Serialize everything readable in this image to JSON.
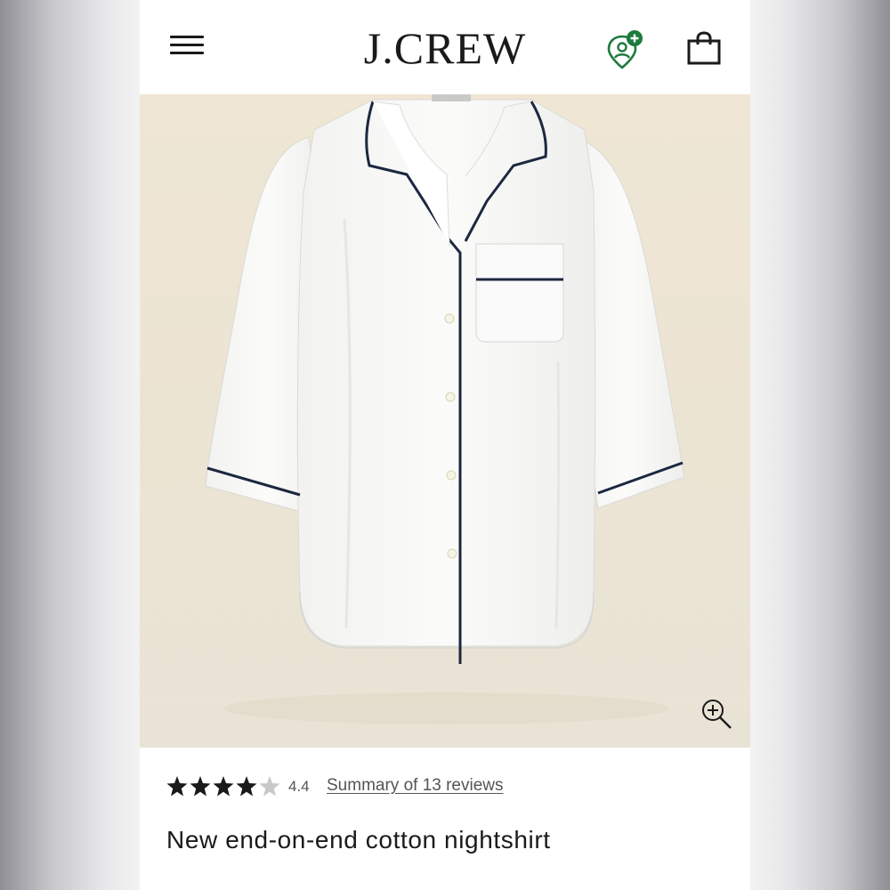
{
  "header": {
    "logo_text": "J.CREW",
    "menu_icon": "hamburger-menu-icon",
    "loyalty_icon": "location-pin-plus-icon",
    "bag_icon": "shopping-bag-icon",
    "accent_color": "#1e7a3c"
  },
  "hero": {
    "background_color": "#ece4d3",
    "zoom_icon": "zoom-in-icon"
  },
  "product": {
    "rating_stars": 4.4,
    "rating_value": "4.4",
    "reviews_link": "Summary of 13 reviews",
    "title": "New end-on-end cotton nightshirt"
  }
}
